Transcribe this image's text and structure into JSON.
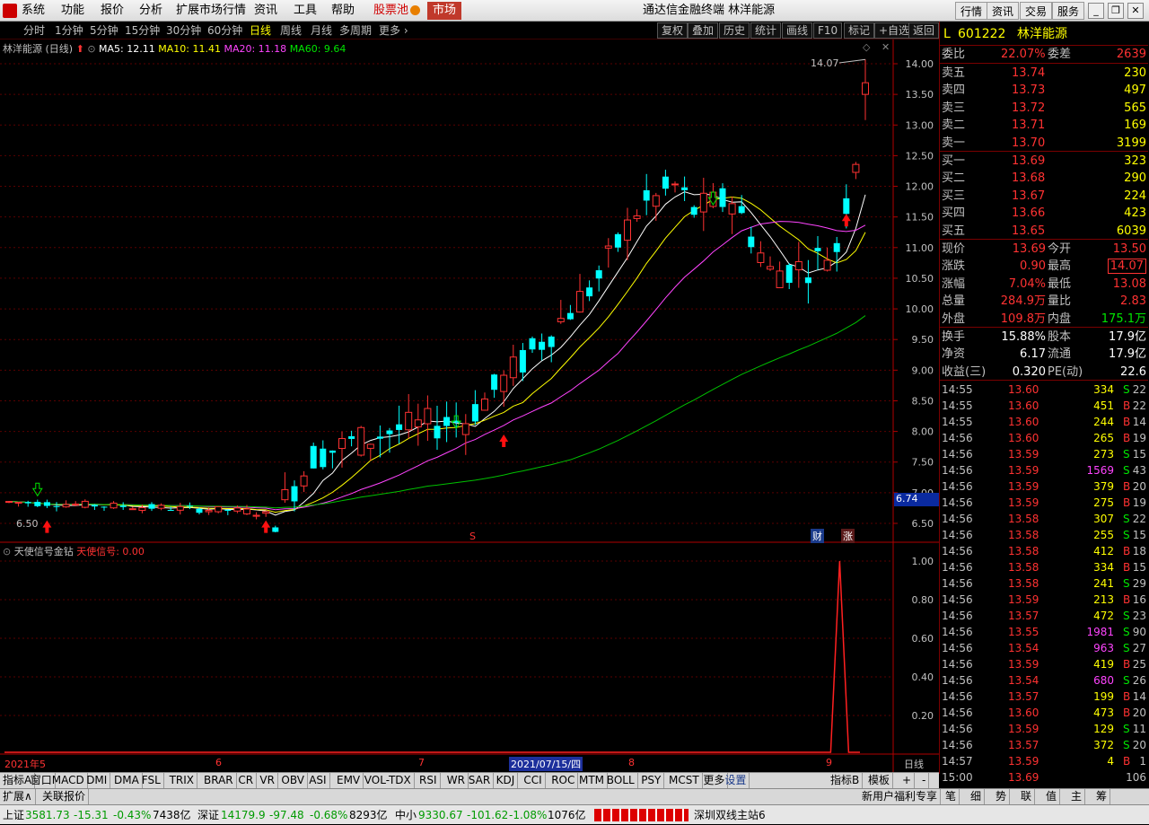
{
  "menu": {
    "items": [
      "系统",
      "功能",
      "报价",
      "分析",
      "扩展市场行情",
      "资讯",
      "工具",
      "帮助"
    ],
    "hot_pool": "股票池",
    "market": "市场",
    "window_title": "通达信金融终端  林洋能源",
    "right_buttons": [
      "行情",
      "资讯",
      "交易",
      "服务"
    ]
  },
  "periods": {
    "items": [
      "分时",
      "1分钟",
      "5分钟",
      "15分钟",
      "30分钟",
      "60分钟",
      "日线",
      "周线",
      "月线",
      "多周期",
      "更多"
    ],
    "active": "日线",
    "right_tools": [
      "复权",
      "叠加",
      "历史",
      "统计",
      "画线",
      "F10",
      "标记",
      "+自选",
      "返回"
    ]
  },
  "main_chart": {
    "title": "林洋能源 (日线)",
    "ma5": "MA5: 12.11",
    "ma10": "MA10: 11.41",
    "ma20": "MA20: 11.18",
    "ma60": "MA60: 9.64",
    "high_label": "14.07",
    "low_label": "6.50",
    "current_tag": "6.74",
    "event_fin": "财",
    "event_up": "涨",
    "event_s": "S",
    "y_ticks": [
      "14.00",
      "13.50",
      "13.00",
      "12.50",
      "12.00",
      "11.50",
      "11.00",
      "10.50",
      "10.00",
      "9.50",
      "9.00",
      "8.50",
      "8.00",
      "7.50",
      "7.00",
      "6.50"
    ]
  },
  "sub_chart": {
    "title": "天使信号金钻",
    "signal_label": "天使信号: 0.00",
    "y_ticks": [
      "1.00",
      "0.80",
      "0.60",
      "0.40",
      "0.20"
    ]
  },
  "x_axis": {
    "labels": [
      "2021年",
      "5",
      "6",
      "7",
      "2021/07/15/四",
      "8",
      "9"
    ],
    "right_label": "日线"
  },
  "indicators": {
    "items": [
      "指标A",
      "窗口",
      "MACD",
      "DMI",
      "DMA",
      "FSL",
      "TRIX",
      "BRAR",
      "CR",
      "VR",
      "OBV",
      "ASI",
      "EMV",
      "VOL-TDX",
      "RSI",
      "WR",
      "SAR",
      "KDJ",
      "CCI",
      "ROC",
      "MTM",
      "BOLL",
      "PSY",
      "MCST",
      "更多",
      "设置"
    ],
    "right_items": [
      "指标B",
      "模板",
      "+",
      "-"
    ]
  },
  "ext_bar": {
    "left": [
      "扩展∧",
      "关联报价"
    ],
    "right": [
      "新用户福利专享",
      "笔",
      "细",
      "势",
      "联",
      "值",
      "主",
      "筹"
    ]
  },
  "quote": {
    "code": "601222",
    "name": "林洋能源",
    "flag": "L",
    "weibi_label": "委比",
    "weibi": "22.07%",
    "weicha_label": "委差",
    "weicha": "2639",
    "asks": [
      {
        "label": "卖五",
        "price": "13.74",
        "vol": "230"
      },
      {
        "label": "卖四",
        "price": "13.73",
        "vol": "497"
      },
      {
        "label": "卖三",
        "price": "13.72",
        "vol": "565"
      },
      {
        "label": "卖二",
        "price": "13.71",
        "vol": "169"
      },
      {
        "label": "卖一",
        "price": "13.70",
        "vol": "3199"
      }
    ],
    "bids": [
      {
        "label": "买一",
        "price": "13.69",
        "vol": "323"
      },
      {
        "label": "买二",
        "price": "13.68",
        "vol": "290"
      },
      {
        "label": "买三",
        "price": "13.67",
        "vol": "224"
      },
      {
        "label": "买四",
        "price": "13.66",
        "vol": "423"
      },
      {
        "label": "买五",
        "price": "13.65",
        "vol": "6039"
      }
    ],
    "stats": [
      {
        "l1": "现价",
        "v1": "13.69",
        "l2": "今开",
        "v2": "13.50"
      },
      {
        "l1": "涨跌",
        "v1": "0.90",
        "l2": "最高",
        "v2": "14.07"
      },
      {
        "l1": "涨幅",
        "v1": "7.04%",
        "l2": "最低",
        "v2": "13.08"
      },
      {
        "l1": "总量",
        "v1": "284.9万",
        "l2": "量比",
        "v2": "2.83"
      },
      {
        "l1": "外盘",
        "v1": "109.8万",
        "l2": "内盘",
        "v2": "175.1万"
      }
    ],
    "stats2": [
      {
        "l1": "换手",
        "v1": "15.88%",
        "l2": "股本",
        "v2": "17.9亿"
      },
      {
        "l1": "净资",
        "v1": "6.17",
        "l2": "流通",
        "v2": "17.9亿"
      },
      {
        "l1": "收益(三)",
        "v1": "0.320",
        "l2": "PE(动)",
        "v2": "22.6"
      }
    ],
    "trades": [
      {
        "t": "14:55",
        "p": "13.60",
        "v": "334",
        "d": "S",
        "n": "22"
      },
      {
        "t": "14:55",
        "p": "13.60",
        "v": "451",
        "d": "B",
        "n": "22"
      },
      {
        "t": "14:55",
        "p": "13.60",
        "v": "244",
        "d": "B",
        "n": "14"
      },
      {
        "t": "14:56",
        "p": "13.60",
        "v": "265",
        "d": "B",
        "n": "19"
      },
      {
        "t": "14:56",
        "p": "13.59",
        "v": "273",
        "d": "S",
        "n": "15"
      },
      {
        "t": "14:56",
        "p": "13.59",
        "v": "1569",
        "d": "S",
        "n": "43"
      },
      {
        "t": "14:56",
        "p": "13.59",
        "v": "379",
        "d": "B",
        "n": "20"
      },
      {
        "t": "14:56",
        "p": "13.59",
        "v": "275",
        "d": "B",
        "n": "19"
      },
      {
        "t": "14:56",
        "p": "13.58",
        "v": "307",
        "d": "S",
        "n": "22"
      },
      {
        "t": "14:56",
        "p": "13.58",
        "v": "255",
        "d": "S",
        "n": "15"
      },
      {
        "t": "14:56",
        "p": "13.58",
        "v": "412",
        "d": "B",
        "n": "18"
      },
      {
        "t": "14:56",
        "p": "13.58",
        "v": "334",
        "d": "B",
        "n": "15"
      },
      {
        "t": "14:56",
        "p": "13.58",
        "v": "241",
        "d": "S",
        "n": "29"
      },
      {
        "t": "14:56",
        "p": "13.59",
        "v": "213",
        "d": "B",
        "n": "16"
      },
      {
        "t": "14:56",
        "p": "13.57",
        "v": "472",
        "d": "S",
        "n": "23"
      },
      {
        "t": "14:56",
        "p": "13.55",
        "v": "1981",
        "d": "S",
        "n": "90"
      },
      {
        "t": "14:56",
        "p": "13.54",
        "v": "963",
        "d": "S",
        "n": "27"
      },
      {
        "t": "14:56",
        "p": "13.59",
        "v": "419",
        "d": "B",
        "n": "25"
      },
      {
        "t": "14:56",
        "p": "13.54",
        "v": "680",
        "d": "S",
        "n": "26"
      },
      {
        "t": "14:56",
        "p": "13.57",
        "v": "199",
        "d": "B",
        "n": "14"
      },
      {
        "t": "14:56",
        "p": "13.60",
        "v": "473",
        "d": "B",
        "n": "20"
      },
      {
        "t": "14:56",
        "p": "13.59",
        "v": "129",
        "d": "S",
        "n": "11"
      },
      {
        "t": "14:56",
        "p": "13.57",
        "v": "372",
        "d": "S",
        "n": "20"
      },
      {
        "t": "14:57",
        "p": "13.59",
        "v": "4",
        "d": "B",
        "n": "1"
      },
      {
        "t": "15:00",
        "p": "13.69",
        "v": "",
        "d": "",
        "n": "106"
      }
    ]
  },
  "status": {
    "sh_label": "上证",
    "sh_val": "3581.73",
    "sh_chg": "-15.31",
    "sh_pct": "-0.43%",
    "sh_amt": "7438亿",
    "sz_label": "深证",
    "sz_val": "14179.9",
    "sz_chg": "-97.48",
    "sz_pct": "-0.68%",
    "sz_amt": "8293亿",
    "zx_label": "中小",
    "zx_val": "9330.67",
    "zx_chg": "-101.62",
    "zx_pct": "-1.08%",
    "zx_amt": "1076亿",
    "site": "深圳双线主站6"
  },
  "chart_data": {
    "type": "candlestick",
    "ylim": [
      6.2,
      14.2
    ],
    "candles": [
      {
        "o": 13.5,
        "h": 14.07,
        "l": 13.08,
        "c": 13.69
      },
      {
        "o": 11.6,
        "h": 12.8,
        "l": 11.4,
        "c": 12.8
      },
      {
        "o": 11.3,
        "h": 12.5,
        "l": 11.2,
        "c": 11.6
      },
      {
        "o": 10.5,
        "h": 11.5,
        "l": 10.0,
        "c": 11.0
      },
      {
        "o": 10.8,
        "h": 11.0,
        "l": 10.1,
        "c": 10.4
      },
      {
        "o": 11.2,
        "h": 11.3,
        "l": 10.6,
        "c": 10.8
      },
      {
        "o": 10.6,
        "h": 11.2,
        "l": 10.5,
        "c": 10.9
      },
      {
        "o": 10.3,
        "h": 10.8,
        "l": 10.1,
        "c": 10.6
      }
    ],
    "signal": {
      "index": 87,
      "value": 1.0
    }
  }
}
